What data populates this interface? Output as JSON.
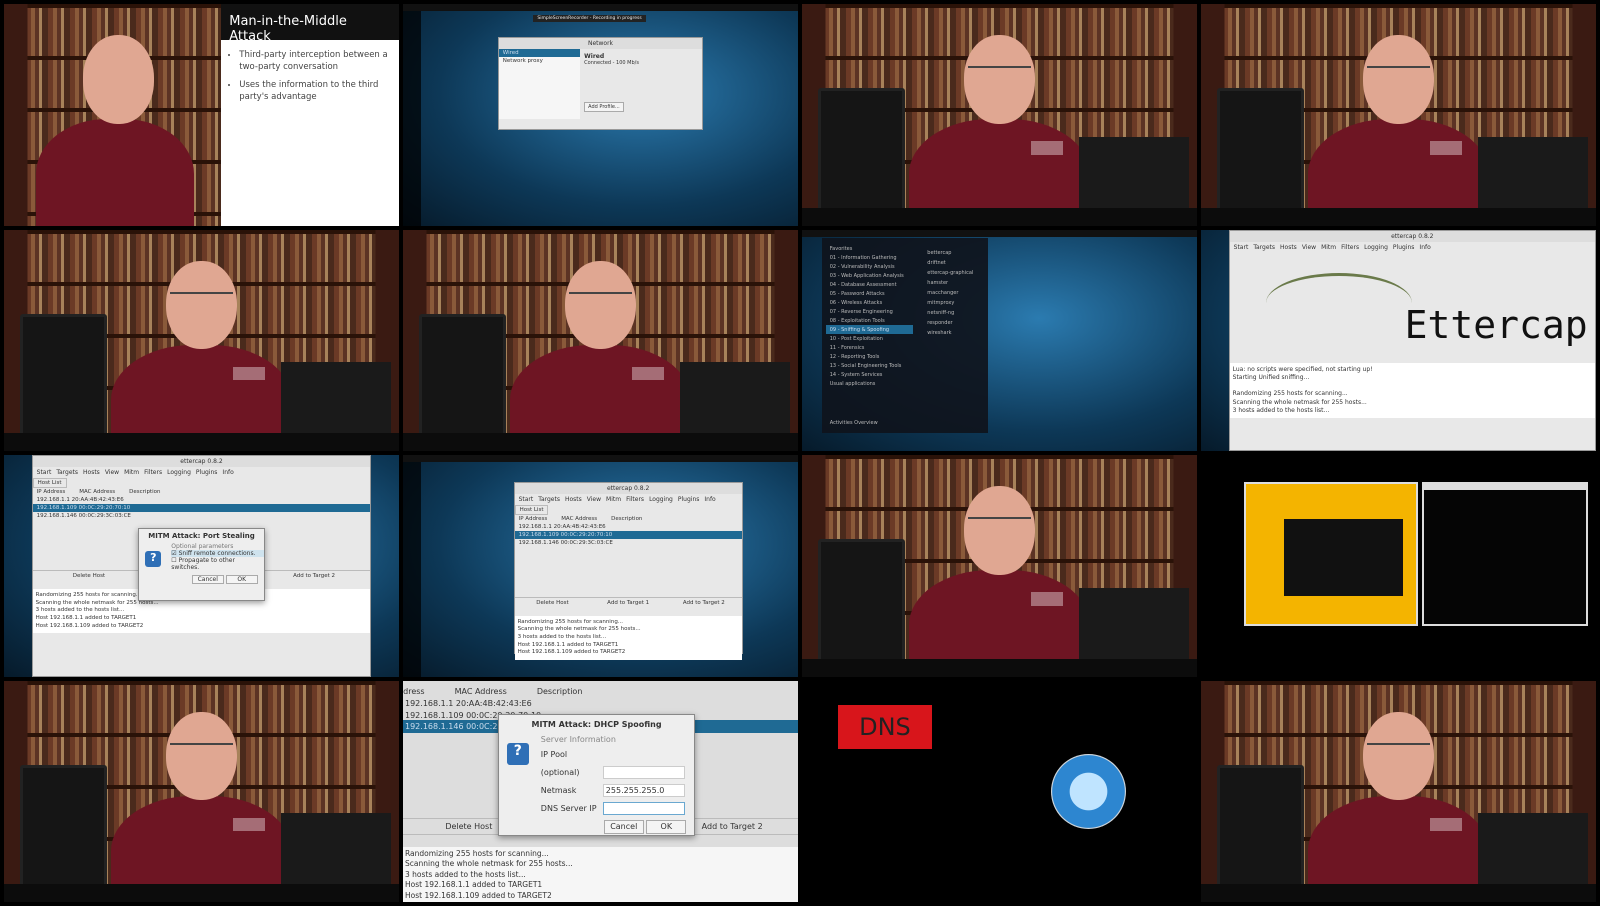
{
  "slide": {
    "title": "Man-in-the-Middle Attack",
    "bullets": [
      "Third-party interception between a two-party conversation",
      "Uses the information to the third party's advantage"
    ]
  },
  "network": {
    "title": "Network",
    "items": [
      "Wired",
      "Network proxy"
    ],
    "wired": "Wired",
    "status": "Connected - 100 Mb/s",
    "add_profile": "Add Profile..."
  },
  "recording": "SimpleScreenRecorder - Recording in progress",
  "kali_menu": {
    "items": [
      "Favorites",
      "01 - Information Gathering",
      "02 - Vulnerability Analysis",
      "03 - Web Application Analysis",
      "04 - Database Assessment",
      "05 - Password Attacks",
      "06 - Wireless Attacks",
      "07 - Reverse Engineering",
      "08 - Exploitation Tools",
      "09 - Sniffing & Spoofing",
      "10 - Post Exploitation",
      "11 - Forensics",
      "12 - Reporting Tools",
      "13 - Social Engineering Tools",
      "14 - System Services",
      "Usual applications"
    ],
    "selected": "09 - Sniffing & Spoofing",
    "footer": "Activities Overview",
    "apps": [
      "bettercap",
      "driftnet",
      "ettercap-graphical",
      "hamster",
      "macchanger",
      "mitmproxy",
      "netsniff-ng",
      "responder",
      "wireshark"
    ]
  },
  "ettercap": {
    "title": "ettercap 0.8.2",
    "menu": [
      "Start",
      "Targets",
      "Hosts",
      "View",
      "Mitm",
      "Filters",
      "Logging",
      "Plugins",
      "Info"
    ],
    "logo_text": "Ettercap",
    "splash_log": [
      "Lua: no scripts were specified, not starting up!",
      "Starting Unified sniffing...",
      "",
      "Randomizing 255 hosts for scanning...",
      "Scanning the whole netmask for 255 hosts...",
      "3 hosts added to the hosts list..."
    ],
    "tab": "Host List",
    "columns": [
      "IP Address",
      "MAC Address",
      "Description"
    ],
    "hosts": [
      [
        "192.168.1.1",
        "20:AA:4B:42:43:E6"
      ],
      [
        "192.168.1.109",
        "00:0C:29:20:70:10"
      ],
      [
        "192.168.1.146",
        "00:0C:29:3C:03:CE"
      ]
    ],
    "buttons": [
      "Delete Host",
      "Add to Target 1",
      "Add to Target 2"
    ],
    "log": [
      "Randomizing 255 hosts for scanning...",
      "Scanning the whole netmask for 255 hosts...",
      "3 hosts added to the hosts list...",
      "Host 192.168.1.1 added to TARGET1",
      "Host 192.168.1.109 added to TARGET2"
    ]
  },
  "port_stealing": {
    "title": "MITM Attack: Port Stealing",
    "section": "Optional parameters",
    "options": [
      {
        "label": "Sniff remote connections.",
        "checked": true
      },
      {
        "label": "Propagate to other switches.",
        "checked": false
      }
    ],
    "cancel": "Cancel",
    "ok": "OK"
  },
  "dhcp": {
    "title": "MITM Attack: DHCP Spoofing",
    "section": "Server Information",
    "fields": [
      {
        "label": "IP Pool (optional)",
        "value": ""
      },
      {
        "label": "Netmask",
        "value": "255.255.255.0"
      },
      {
        "label": "DNS Server IP",
        "value": ""
      }
    ],
    "cancel": "Cancel",
    "ok": "OK"
  },
  "dns_label": "DNS"
}
